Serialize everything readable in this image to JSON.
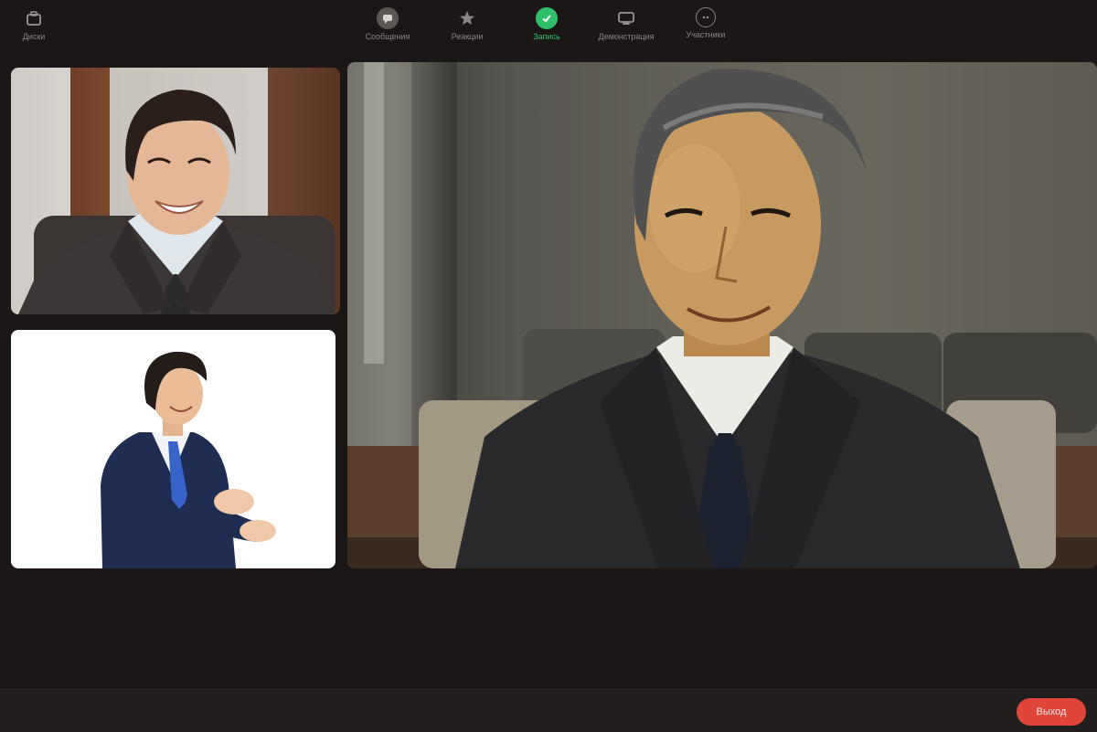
{
  "participants": [
    {
      "id": "participant-a"
    },
    {
      "id": "participant-b"
    },
    {
      "id": "participant-c"
    }
  ],
  "toolbar": {
    "left": {
      "label": "Диски",
      "icon": "briefcase-icon"
    },
    "center": [
      {
        "label": "Сообщения",
        "icon": "chat-icon"
      },
      {
        "label": "Реакции",
        "icon": "star-icon"
      },
      {
        "label": "Запись",
        "icon": "check-circle-icon",
        "active": true
      },
      {
        "label": "Демонстрация",
        "icon": "screen-share-icon"
      },
      {
        "label": "Участники",
        "icon": "participants-icon"
      }
    ],
    "end_label": "Выход"
  },
  "colors": {
    "background": "#1b1716",
    "toolbar": "#221e1d",
    "accent_green": "#2fbf6a",
    "end_red": "#e0453a"
  }
}
